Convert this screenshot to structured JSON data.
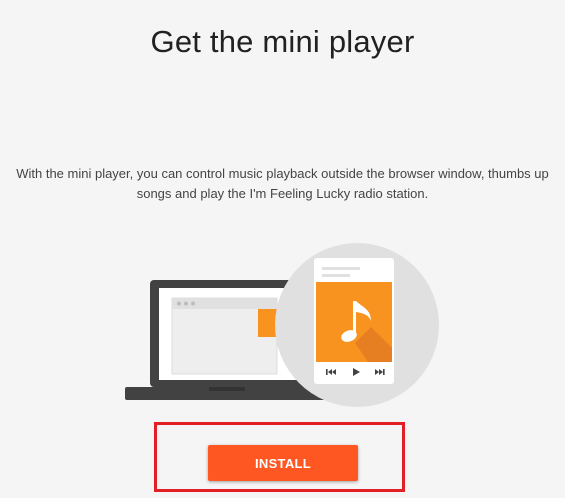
{
  "dialog": {
    "title": "Get the mini player",
    "description": "With the mini player, you can control music playback outside the browser window, thumbs up songs and play the I'm Feeling Lucky radio station.",
    "install_label": "INSTALL"
  },
  "illustration": {
    "icons": [
      "laptop-icon",
      "mini-player-icon",
      "music-note-icon",
      "previous-track-icon",
      "play-icon",
      "next-track-icon"
    ]
  },
  "colors": {
    "accent": "#ff5722",
    "player_orange": "#f7931e",
    "laptop": "#424242",
    "circle": "#e0e0e0",
    "highlight": "#e31e24"
  }
}
